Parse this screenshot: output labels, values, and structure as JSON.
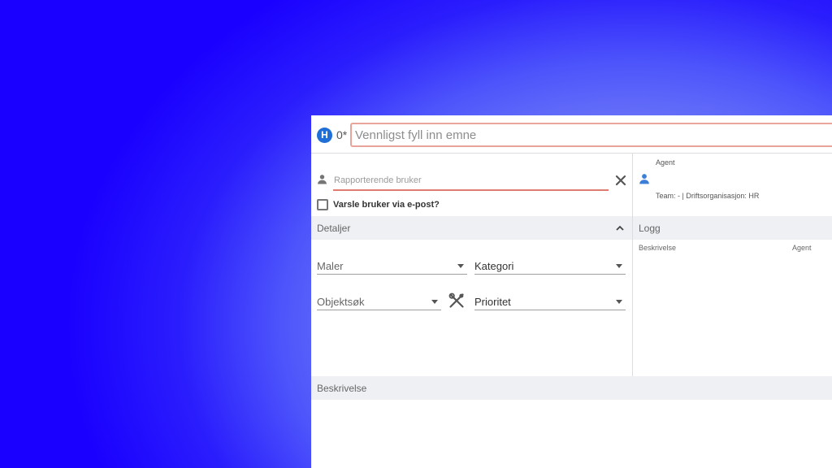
{
  "header": {
    "badge": "H",
    "id_text": "0*",
    "subject_placeholder": "Vennligst fyll inn emne"
  },
  "reporter": {
    "placeholder": "Rapporterende bruker",
    "notify_label": "Varsle bruker via e-post?"
  },
  "details": {
    "title": "Detaljer",
    "templates_label": "Maler",
    "category_label": "Kategori",
    "object_search_label": "Objektsøk",
    "priority_label": "Prioritet"
  },
  "assignment": {
    "agent_label": "Agent",
    "team_text": "Team: - | Driftsorganisasjon: HR"
  },
  "log": {
    "title": "Logg",
    "columns": [
      "Beskrivelse",
      "Agent"
    ]
  },
  "description": {
    "title": "Beskrivelse"
  },
  "colors": {
    "accent": "#1f6fd6",
    "error": "#e07b70",
    "section_bar": "#eef0f3"
  }
}
